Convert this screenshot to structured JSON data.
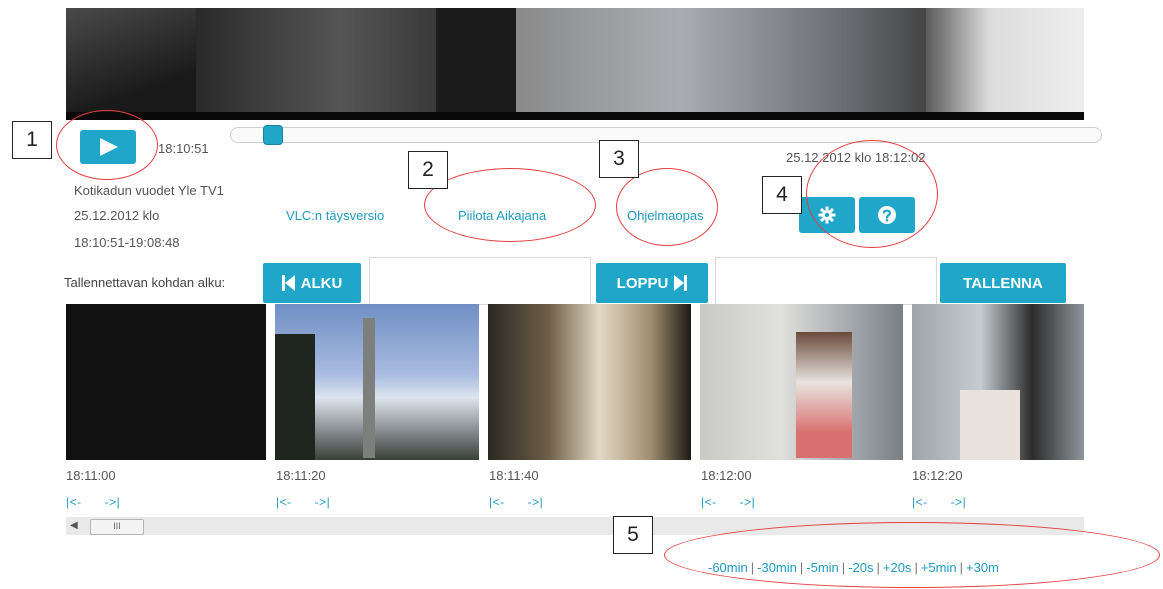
{
  "player": {
    "play_icon": "play-icon",
    "current_time": "18:10:51",
    "position_fraction": 0.03,
    "date_time": "25.12.2012 klo 18:12:02"
  },
  "program": {
    "title": "Kotikadun vuodet Yle TV1",
    "date": "25.12.2012 klo",
    "time_range": "18:10:51-19:08:48"
  },
  "links": {
    "vlc": "VLC:n täysversio",
    "hide_timeline": "Piilota Aikajana",
    "guide": "Ohjelmaopas"
  },
  "buttons": {
    "settings_icon": "gear-icon",
    "help_icon": "help-icon"
  },
  "recording": {
    "label": "Tallennettavan kohdan alku:",
    "start_label": "ALKU",
    "start_value": "",
    "end_label": "LOPPU",
    "end_value": "",
    "save_label": "TALLENNA"
  },
  "thumbnails": [
    {
      "time": "18:11:00",
      "prev": "|<-",
      "next": "->|"
    },
    {
      "time": "18:11:20",
      "prev": "|<-",
      "next": "->|"
    },
    {
      "time": "18:11:40",
      "prev": "|<-",
      "next": "->|"
    },
    {
      "time": "18:12:00",
      "prev": "|<-",
      "next": "->|"
    },
    {
      "time": "18:12:20",
      "prev": "|<-",
      "next": "->|"
    }
  ],
  "scrollbar": {
    "thumb_grip": "III"
  },
  "jumps": [
    "-60min",
    "-30min",
    "-5min",
    "-20s",
    "+20s",
    "+5min",
    "+30m"
  ],
  "callouts": [
    "1",
    "2",
    "3",
    "4",
    "5"
  ],
  "colors": {
    "accent": "#1fa6c8",
    "link": "#1f9bc0",
    "annotation": "#e34040"
  }
}
